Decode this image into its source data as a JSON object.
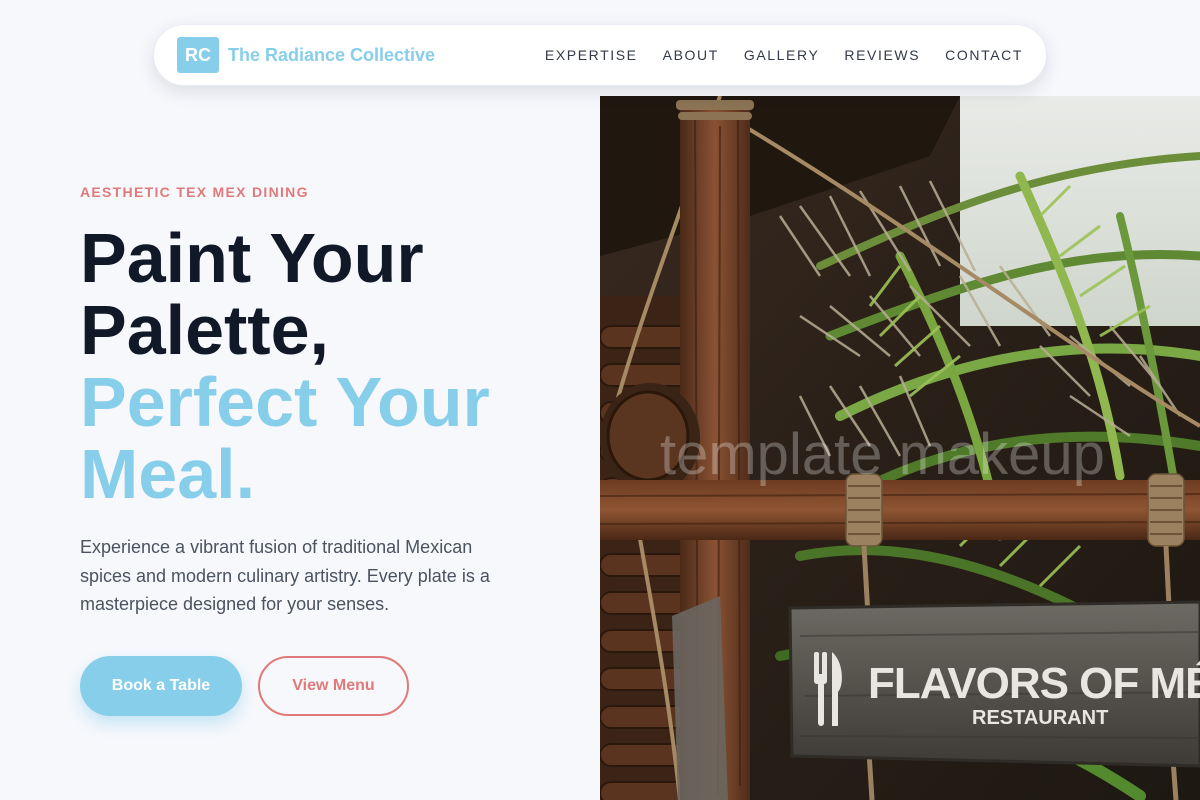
{
  "nav": {
    "logo_mark": "RC",
    "brand_name": "The Radiance Collective",
    "links": [
      "EXPERTISE",
      "ABOUT",
      "GALLERY",
      "REVIEWS",
      "CONTACT"
    ]
  },
  "hero": {
    "eyebrow": "AESTHETIC TEX MEX DINING",
    "headline_line1": "Paint Your",
    "headline_line2": "Palette,",
    "headline_accent_line1": "Perfect Your",
    "headline_accent_line2": "Meal.",
    "description": "Experience a vibrant fusion of traditional Mexican spices and modern culinary artistry. Every plate is a masterpiece designed for your senses.",
    "primary_button": "Book a Table",
    "secondary_button": "View Menu"
  },
  "image": {
    "sign_title": "FLAVORS OF MÉXICO",
    "sign_subtitle": "RESTAURANT",
    "watermark": "template makeup"
  },
  "colors": {
    "accent": "#87ceeb",
    "coral": "#e07a7a",
    "heading": "#111827",
    "background": "#f7f8fc"
  }
}
